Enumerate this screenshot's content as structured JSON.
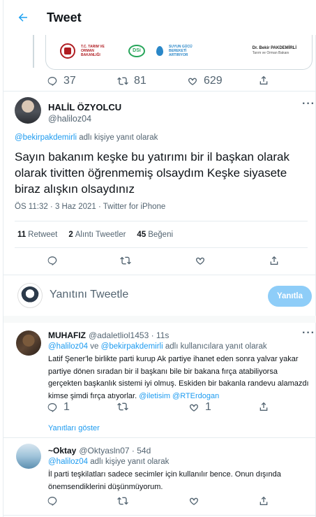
{
  "header": {
    "title": "Tweet"
  },
  "parent_tweet": {
    "media": {
      "tc_text": "T.C. TARIM VE ORMAN BAKANLIĞI",
      "dsi_text": "DSi",
      "sg_text": "SUYUN GÜCÜ BEREKETİ ARTIRIYOR",
      "sig_name": "Dr. Bekir PAKDEMİRLİ",
      "sig_title": "Tarım ve Orman Bakanı"
    },
    "replies": "37",
    "retweets": "81",
    "likes": "629"
  },
  "main_tweet": {
    "name": "HALİL ÖZYOLCU",
    "handle": "@haliloz04",
    "reply_mention": "@bekirpakdemirli",
    "reply_suffix": "adlı kişiye yanıt olarak",
    "text": "Sayın bakanım keşke bu yatırımı bir il başkan olarak olarak tivitten öğrenmemiş olsaydım Keşke siyasete biraz alışkın olsaydınız",
    "meta": "ÖS 11:32 · 3 Haz 2021 · Twitter for iPhone",
    "stats": [
      {
        "count": "11",
        "label": "Retweet"
      },
      {
        "count": "2",
        "label": "Alıntı Tweetler"
      },
      {
        "count": "45",
        "label": "Beğeni"
      }
    ]
  },
  "composer": {
    "placeholder": "Yanıtını Tweetle",
    "button": "Yanıtla"
  },
  "replies": [
    {
      "name": "MUHAFIZ",
      "handle": "@adaletliol1453",
      "time": "· 11s",
      "mention_a": "@haliloz04",
      "joiner": "ve",
      "mention_b": "@bekirpakdemirli",
      "context_suffix": "adlı kullanıcılara yanıt olarak",
      "text": "Latif Şener'le birlikte parti kurup Ak partiye ihanet eden sonra yalvar yakar partiye dönen sıradan bir il başkanı bile bir bakana fırça atabiliyorsa gerçekten başkanlık sistemi iyi olmuş. Eskiden bir bakanla randevu alamazdı kimse şimdi fırça atıyorlar.",
      "mention_c": "@iletisim",
      "mention_d": "@RTErdogan",
      "replies": "1",
      "likes": "1",
      "show_replies": "Yanıtları göster"
    },
    {
      "name": "~Oktay",
      "handle": "@Oktyasln07",
      "time": "· 54d",
      "mention_a": "@haliloz04",
      "context_suffix": "adlı kişiye yanıt olarak",
      "text": "İl parti teşkilatları sadece secimler için kullanılır bence. Onun dışında önemsendiklerini düşünmüyorum."
    }
  ]
}
